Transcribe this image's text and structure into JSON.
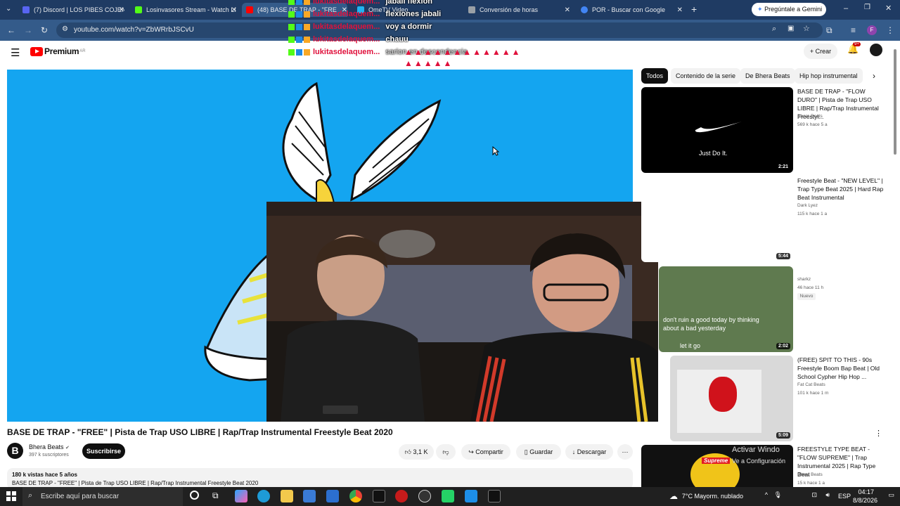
{
  "browser": {
    "tabs": [
      {
        "label": "(7) Discord | LOS PIBES COJEN",
        "icon": "discord-icon",
        "color": "#5865f2"
      },
      {
        "label": "Losinvasores Stream - Watch Li",
        "icon": "kick-icon",
        "color": "#53fc18"
      },
      {
        "label": "(48) BASE DE TRAP - \"FRE",
        "icon": "youtube-icon",
        "color": "#ff0000"
      },
      {
        "label": "OmeTV Video",
        "icon": "ometv-icon",
        "color": "#21b3f2"
      },
      {
        "label": "Conversión de horas",
        "icon": "clock-icon",
        "color": "#9aa0a6"
      },
      {
        "label": "POR - Buscar con Google",
        "icon": "google-icon",
        "color": "#4285f4"
      }
    ],
    "gemini_button": "Pregúntale a Gemini",
    "url": "youtube.com/watch?v=ZbWRrbJSCvU"
  },
  "youtube": {
    "logo_text": "Premium",
    "logo_sup": "AR",
    "create_label": "Crear",
    "notif_count": "9+",
    "video_title": "BASE DE TRAP - \"FREE\" | Pista de Trap USO LIBRE | Rap/Trap Instrumental Freestyle Beat 2020",
    "channel": {
      "name": "Bhera Beats",
      "subs": "397 k suscriptores",
      "avatar_letter": "B"
    },
    "subscribe_label": "Suscribirse",
    "likes": "3,1 K",
    "share_label": "Compartir",
    "save_label": "Guardar",
    "download_label": "Descargar",
    "description": {
      "views": "180 k vistas  hace 5 años",
      "text": "BASE DE TRAP - \"FREE\" | Pista de Trap USO LIBRE | Rap/Trap Instrumental Freestyle Beat 2020"
    },
    "chips": [
      "Todos",
      "Contenido de la serie",
      "De Bhera Beats",
      "Hip hop instrumental"
    ],
    "recommendations": [
      {
        "title": "BASE DE TRAP - \"FLOW DURO\" | Pista de Trap USO LIBRE | Rap/Trap Instrumental Freestyl...",
        "channel": "Bhera Beats",
        "meta": "569 k  hace 5 a",
        "duration": "2:21",
        "thumb_text": "Just Do It."
      },
      {
        "title": "Freestyle Beat - \"NEW LEVEL\" | Trap Type Beat 2025 | Hard Rap Beat Instrumental",
        "channel": "Dark Lyez",
        "meta": "115 k  hace 1 a",
        "duration": "5:44"
      },
      {
        "title": "",
        "channel": "sharkz",
        "meta": "46  hace 11 h",
        "badge": "Nuevo",
        "duration": "2:02",
        "thumb_text": "don't ruin a good today by thinking about a bad yesterday",
        "thumb_text2": "let it go"
      },
      {
        "title": "(FREE) SPIT TO THIS - 90s Freestyle Boom Bap Beat | Old School Cypher Hip Hop ...",
        "channel": "Fat Cat Beats",
        "meta": "101 k  hace 1 m",
        "duration": "5:09"
      },
      {
        "title": "FREESTYLE TYPE BEAT - \"FLOW SUPREME\" | Trap Instrumental 2025 | Rap Type Beat",
        "channel": "Bhera Beats",
        "meta": "15 k  hace 1 a",
        "thumb_text": "Supreme"
      }
    ],
    "activate_windows": [
      "Activar Windo",
      "Ve a Configuración"
    ]
  },
  "chat": [
    {
      "name": "lukitasdelaquem...",
      "msg": "jabali flexion"
    },
    {
      "name": "lukitasdelaquem...",
      "msg": "flexiones jabali"
    },
    {
      "name": "lukitasdelaquem...",
      "msg": "voy a dormir"
    },
    {
      "name": "lukitasdelaquem...",
      "msg": "chauu"
    },
    {
      "name": "lukitasdelaquem...",
      "msg": "sarion en descendencia"
    }
  ],
  "taskbar": {
    "search_placeholder": "Escribe aquí para buscar",
    "weather": "7°C  Mayorm. nublado",
    "lang": "ESP",
    "time": "04:17",
    "date": "8/8/2026"
  }
}
